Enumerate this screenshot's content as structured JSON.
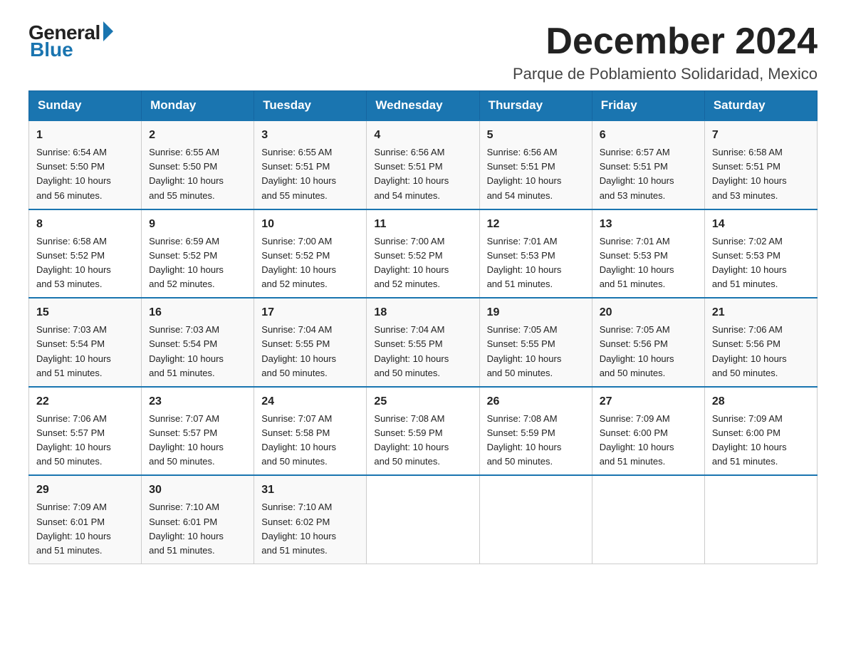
{
  "header": {
    "logo_general": "General",
    "logo_blue": "Blue",
    "month_title": "December 2024",
    "location": "Parque de Poblamiento Solidaridad, Mexico"
  },
  "days_of_week": [
    "Sunday",
    "Monday",
    "Tuesday",
    "Wednesday",
    "Thursday",
    "Friday",
    "Saturday"
  ],
  "weeks": [
    [
      {
        "day": "1",
        "sunrise": "6:54 AM",
        "sunset": "5:50 PM",
        "daylight": "10 hours and 56 minutes."
      },
      {
        "day": "2",
        "sunrise": "6:55 AM",
        "sunset": "5:50 PM",
        "daylight": "10 hours and 55 minutes."
      },
      {
        "day": "3",
        "sunrise": "6:55 AM",
        "sunset": "5:51 PM",
        "daylight": "10 hours and 55 minutes."
      },
      {
        "day": "4",
        "sunrise": "6:56 AM",
        "sunset": "5:51 PM",
        "daylight": "10 hours and 54 minutes."
      },
      {
        "day": "5",
        "sunrise": "6:56 AM",
        "sunset": "5:51 PM",
        "daylight": "10 hours and 54 minutes."
      },
      {
        "day": "6",
        "sunrise": "6:57 AM",
        "sunset": "5:51 PM",
        "daylight": "10 hours and 53 minutes."
      },
      {
        "day": "7",
        "sunrise": "6:58 AM",
        "sunset": "5:51 PM",
        "daylight": "10 hours and 53 minutes."
      }
    ],
    [
      {
        "day": "8",
        "sunrise": "6:58 AM",
        "sunset": "5:52 PM",
        "daylight": "10 hours and 53 minutes."
      },
      {
        "day": "9",
        "sunrise": "6:59 AM",
        "sunset": "5:52 PM",
        "daylight": "10 hours and 52 minutes."
      },
      {
        "day": "10",
        "sunrise": "7:00 AM",
        "sunset": "5:52 PM",
        "daylight": "10 hours and 52 minutes."
      },
      {
        "day": "11",
        "sunrise": "7:00 AM",
        "sunset": "5:52 PM",
        "daylight": "10 hours and 52 minutes."
      },
      {
        "day": "12",
        "sunrise": "7:01 AM",
        "sunset": "5:53 PM",
        "daylight": "10 hours and 51 minutes."
      },
      {
        "day": "13",
        "sunrise": "7:01 AM",
        "sunset": "5:53 PM",
        "daylight": "10 hours and 51 minutes."
      },
      {
        "day": "14",
        "sunrise": "7:02 AM",
        "sunset": "5:53 PM",
        "daylight": "10 hours and 51 minutes."
      }
    ],
    [
      {
        "day": "15",
        "sunrise": "7:03 AM",
        "sunset": "5:54 PM",
        "daylight": "10 hours and 51 minutes."
      },
      {
        "day": "16",
        "sunrise": "7:03 AM",
        "sunset": "5:54 PM",
        "daylight": "10 hours and 51 minutes."
      },
      {
        "day": "17",
        "sunrise": "7:04 AM",
        "sunset": "5:55 PM",
        "daylight": "10 hours and 50 minutes."
      },
      {
        "day": "18",
        "sunrise": "7:04 AM",
        "sunset": "5:55 PM",
        "daylight": "10 hours and 50 minutes."
      },
      {
        "day": "19",
        "sunrise": "7:05 AM",
        "sunset": "5:55 PM",
        "daylight": "10 hours and 50 minutes."
      },
      {
        "day": "20",
        "sunrise": "7:05 AM",
        "sunset": "5:56 PM",
        "daylight": "10 hours and 50 minutes."
      },
      {
        "day": "21",
        "sunrise": "7:06 AM",
        "sunset": "5:56 PM",
        "daylight": "10 hours and 50 minutes."
      }
    ],
    [
      {
        "day": "22",
        "sunrise": "7:06 AM",
        "sunset": "5:57 PM",
        "daylight": "10 hours and 50 minutes."
      },
      {
        "day": "23",
        "sunrise": "7:07 AM",
        "sunset": "5:57 PM",
        "daylight": "10 hours and 50 minutes."
      },
      {
        "day": "24",
        "sunrise": "7:07 AM",
        "sunset": "5:58 PM",
        "daylight": "10 hours and 50 minutes."
      },
      {
        "day": "25",
        "sunrise": "7:08 AM",
        "sunset": "5:59 PM",
        "daylight": "10 hours and 50 minutes."
      },
      {
        "day": "26",
        "sunrise": "7:08 AM",
        "sunset": "5:59 PM",
        "daylight": "10 hours and 50 minutes."
      },
      {
        "day": "27",
        "sunrise": "7:09 AM",
        "sunset": "6:00 PM",
        "daylight": "10 hours and 51 minutes."
      },
      {
        "day": "28",
        "sunrise": "7:09 AM",
        "sunset": "6:00 PM",
        "daylight": "10 hours and 51 minutes."
      }
    ],
    [
      {
        "day": "29",
        "sunrise": "7:09 AM",
        "sunset": "6:01 PM",
        "daylight": "10 hours and 51 minutes."
      },
      {
        "day": "30",
        "sunrise": "7:10 AM",
        "sunset": "6:01 PM",
        "daylight": "10 hours and 51 minutes."
      },
      {
        "day": "31",
        "sunrise": "7:10 AM",
        "sunset": "6:02 PM",
        "daylight": "10 hours and 51 minutes."
      },
      null,
      null,
      null,
      null
    ]
  ],
  "labels": {
    "sunrise": "Sunrise:",
    "sunset": "Sunset:",
    "daylight": "Daylight:"
  }
}
